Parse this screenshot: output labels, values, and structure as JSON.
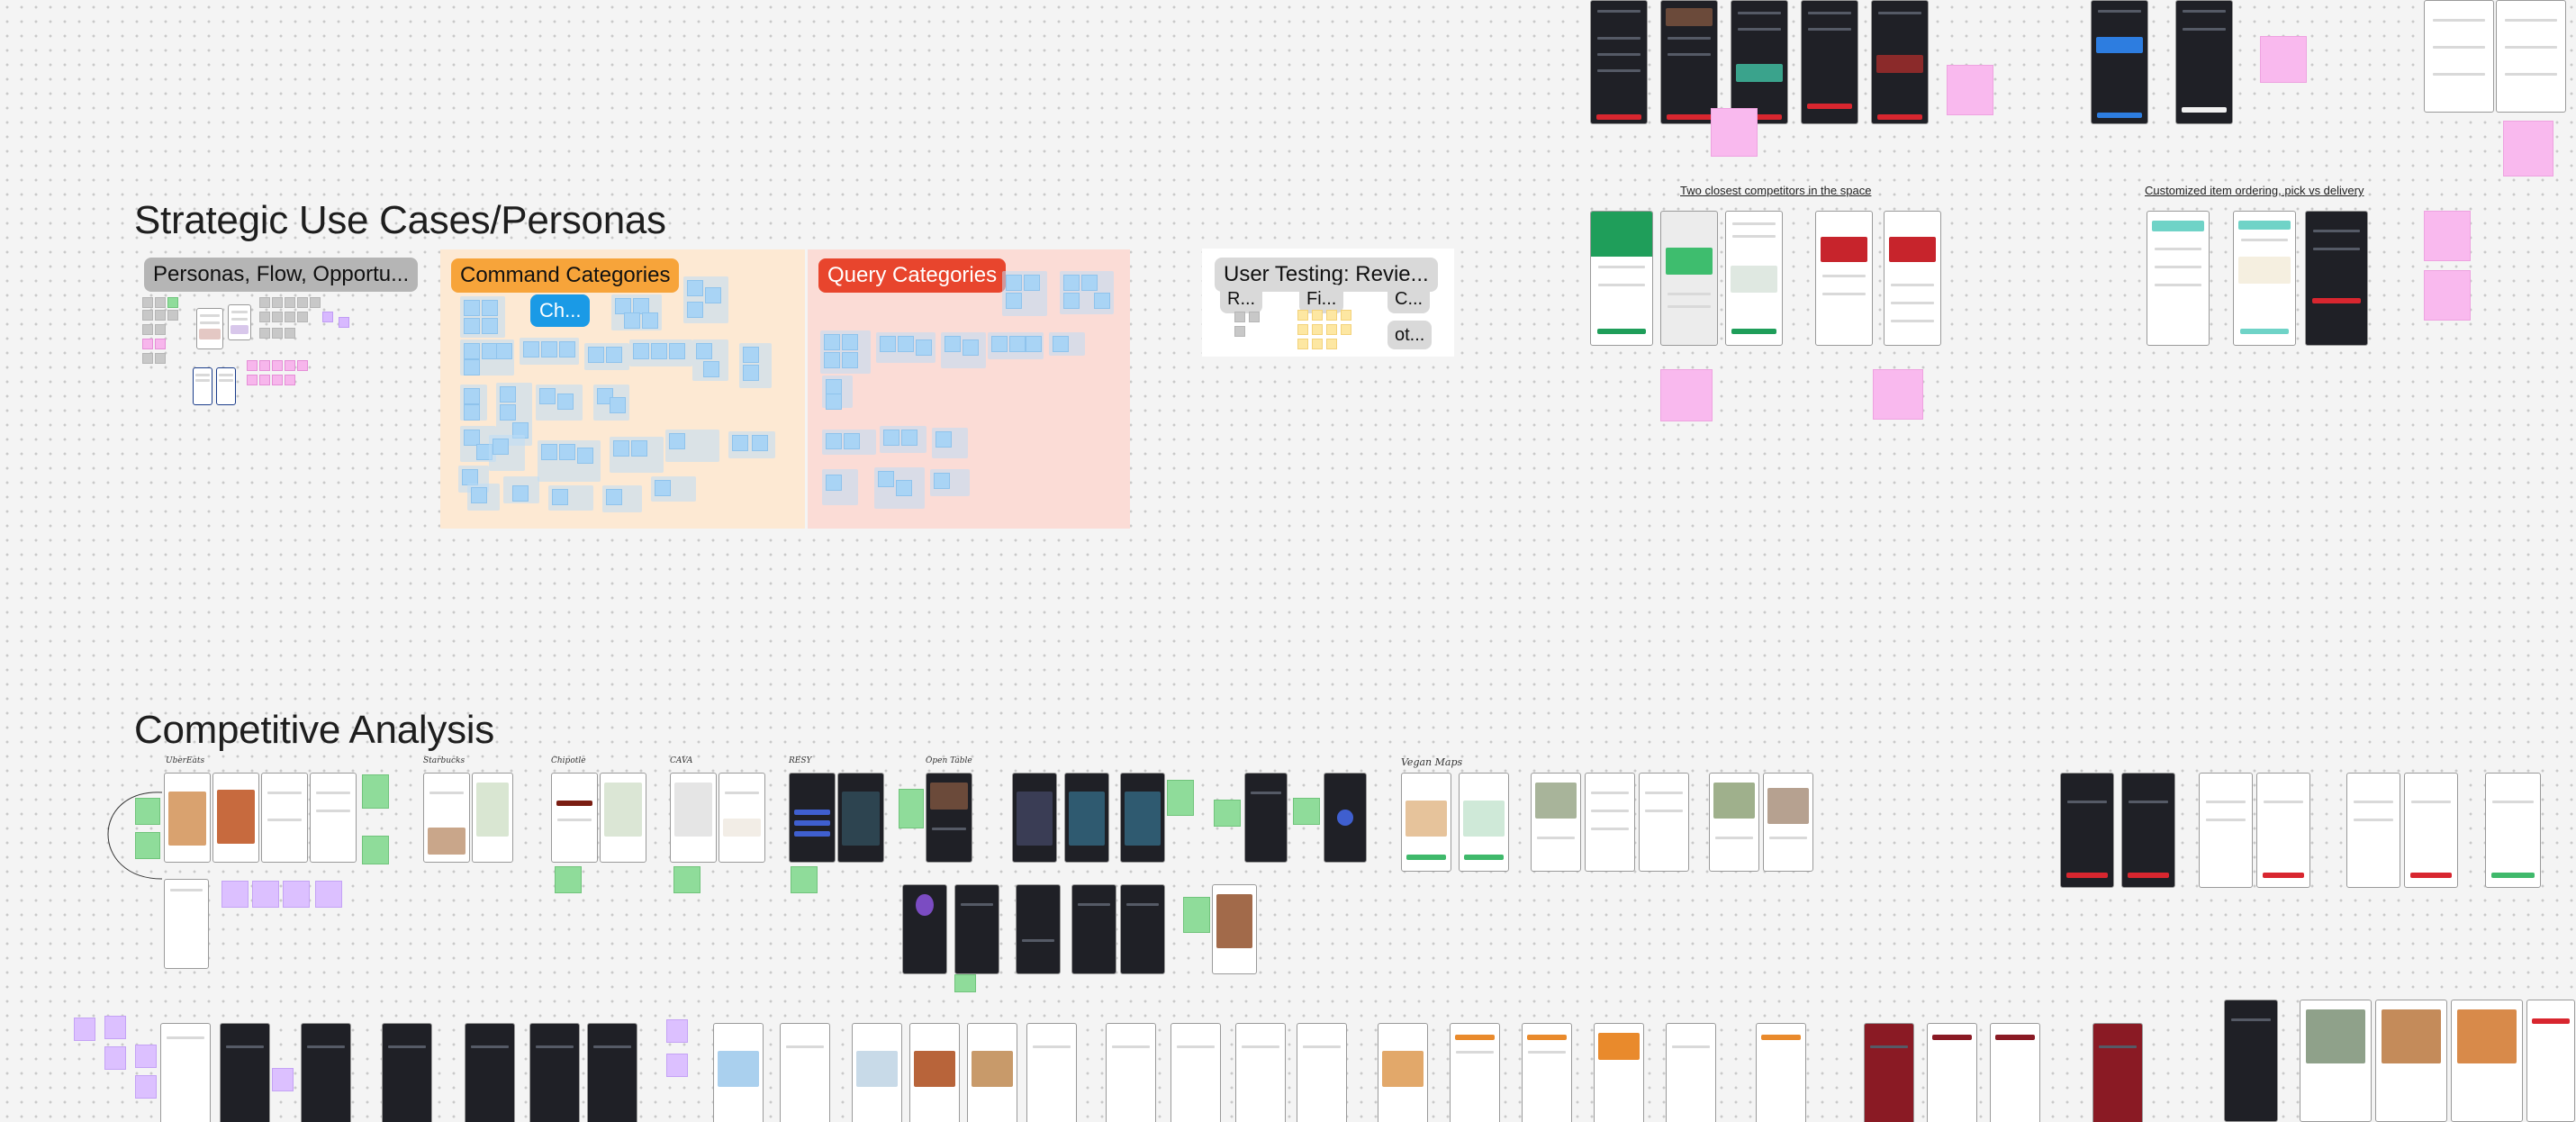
{
  "canvas": {
    "colors": {
      "background": "#f4f4f4",
      "dot": "#c9c9c9"
    }
  },
  "headings": {
    "strategic": "Strategic Use Cases/Personas",
    "competitive": "Competitive Analysis"
  },
  "section_labels": {
    "personas": "Personas, Flow, Opportu...",
    "command_categories": "Command Categories",
    "command_sub": "Ch...",
    "query_categories": "Query Categories",
    "user_testing": "User Testing: Revie...",
    "ut_sub_1": "R...",
    "ut_sub_2": "Fi...",
    "ut_sub_3": "C...",
    "ut_sub_4": "ot..."
  },
  "board_labels": {
    "competitors": "Two closest competitors in the space",
    "ordering": "Customized item ordering, pick vs delivery"
  },
  "competitive_labels": {
    "ubereats": "UberEats",
    "starbucks": "Starbucks",
    "chipotle": "Chipotle",
    "cava": "CAVA",
    "resy": "RESY",
    "opentable": "Open Table",
    "veganmaps": "Vegan Maps"
  },
  "colors": {
    "command_bg": "#fde9d3",
    "command_pill": "#f7a43a",
    "query_bg": "#fbdcd6",
    "query_pill": "#e8452d",
    "personas_pill": "#b5b5b5",
    "sub_pill": "#1a9ae6",
    "sticky_blue": "#a9d4f5",
    "sticky_green": "#8fdc9a",
    "sticky_pink": "#f7b6ec",
    "sticky_purple": "#d8b9ff"
  }
}
